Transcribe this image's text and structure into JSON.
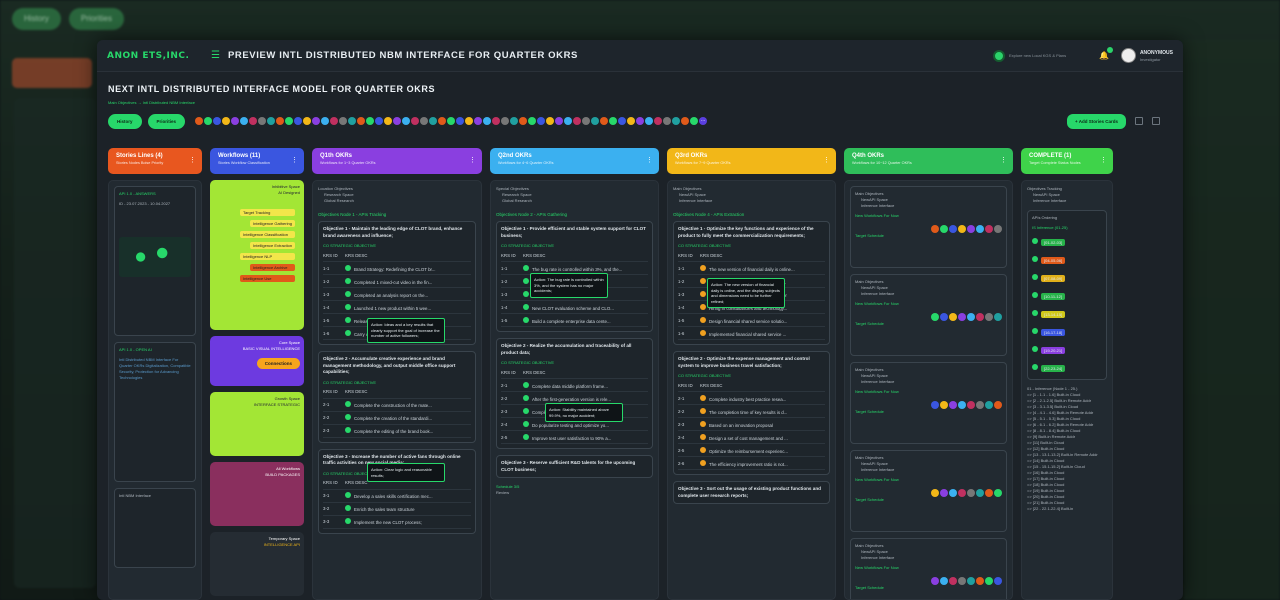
{
  "bg": {
    "history": "History",
    "settings": "Priorities",
    "col_title": "Stories Lines (4)"
  },
  "app": {
    "logo": "ANON ETS,INC.",
    "title": "PREVIEW INTL DISTRIBUTED NBM INTERFACE FOR QUARTER OKRS",
    "search_placeholder": "Explore new Local KGS & Plans",
    "user": "ANONYMOUS",
    "role": "Investigator"
  },
  "page": {
    "title": "NEXT INTL DISTRIBUTED INTERFACE MODEL FOR QUARTER OKRS",
    "breadcrumb": "Main Objectives → Intl Distributed NBM Interface",
    "history_btn": "History",
    "priorities_btn": "Priorities",
    "add_btn": "+ Add Stories Cards",
    "avatar_more": "..."
  },
  "columns": [
    {
      "title": "Stories Lines (4)",
      "sub": "Stories Nodes Boise Priority",
      "color": "#e8571f"
    },
    {
      "title": "Workflows (11)",
      "sub": "Stories Workflow Classification",
      "color": "#3a56e0"
    },
    {
      "title": "Q1th OKRs",
      "sub": "Workflows for 1~3 Quarter OKRs",
      "color": "#8a3fe0"
    },
    {
      "title": "Q2nd OKRs",
      "sub": "Workflows for 4~6 Quarter OKRs",
      "color": "#3bb0f0"
    },
    {
      "title": "Q3rd OKRs",
      "sub": "Workflows for 7~9 Quarter OKRs",
      "color": "#f2b718"
    },
    {
      "title": "Q4th OKRs",
      "sub": "Workflows for 10~12 Quarter OKRs",
      "color": "#2fbe5a"
    },
    {
      "title": "COMPLETE (1)",
      "sub": "Target Complete Status Nodes",
      "color": "#3fd34a"
    }
  ],
  "stories": {
    "card1_label": "API 1.0 - ANSWERS",
    "card1_text": "ID - 23.07.2023 - 10.04.2027",
    "card2_label": "API 1.0 - OPEN AI",
    "card2_text": "Intl Distributed NBM Interface For Quarter OKRs Digitalization, Compatible Security, Protection for Advancing Technologies",
    "card3_label": "Intl NBM Interface"
  },
  "workflows": {
    "w1_label": "Inhibitive Space",
    "w1_sub": "AI Designed",
    "flow": [
      "Target Tracking",
      "Intelligence Gathering",
      "Intelligence Classification",
      "Intelligence Extraction",
      "Intelligence NLP",
      "Intelligence Archive",
      "Intelligence Use"
    ],
    "w2_label": "Core Space",
    "w2_sub": "BASIC VISUAL INTELLIGENCE",
    "w2_btn": "Connections",
    "w3_label": "Growth Space",
    "w3_sub": "INTERFACE STRATEGIC",
    "w4_label": "All Workflows",
    "w4_sub": "BUILD PACKAGES",
    "w5_label": "Temporary Space",
    "w5_sub": "INTELLIGENCE API"
  },
  "q1": {
    "tags": [
      "Location Objectives",
      "Research Space",
      "Global Research"
    ],
    "section": "Objectives Node 1 - APIs Tracking",
    "obj1": "Objective 1 - Maintain the leading edge of CLOT brand, enhance brand awareness and influence;",
    "strat": "CO STRATEGIC OBJECTIVE",
    "krs_id": "KRS ID",
    "krs_desc": "KRS DESC",
    "rows1": [
      [
        "1-1",
        "Brand Strategy: Redefining the CLOT br..."
      ],
      [
        "1-2",
        "Completed 1 mixed-cut video in the fin..."
      ],
      [
        "1-3",
        "Completed an analysis report on the..."
      ],
      [
        "1-4",
        "Launched 1 new product within 5 wee..."
      ],
      [
        "1-5",
        "Release the brand booklet with the tr..."
      ],
      [
        "1-6",
        "Carry out at least 10 online forwarding..."
      ]
    ],
    "tip1": "Action: Ideas and a key results that clearly support the goal of increase the number of active followers;",
    "obj2": "Objective 2 - Accumulate creative experience and brand management methodology, and output middle office support capabilities;",
    "rows2": [
      [
        "2-1",
        "Complete the construction of the mate..."
      ],
      [
        "2-2",
        "Complete the creation of the standardi..."
      ],
      [
        "2-3",
        "Complete the editing of the brand book..."
      ]
    ],
    "tip2": "Action: Clear logic and reasonable results;",
    "obj3": "Objective 3 - Increase the number of active fans through online traffic activities on new social media;",
    "rows3": [
      [
        "3-1",
        "Develop a sales skills certification mec..."
      ],
      [
        "3-2",
        "Enrich the sales team structure"
      ],
      [
        "3-3",
        "Implement the new CLOT process;"
      ]
    ]
  },
  "q2": {
    "tags": [
      "Special Objectives",
      "Research Space",
      "Global Research"
    ],
    "section": "Objectives Node 2 - APIs Gathering",
    "obj1": "Objective 1 - Provide efficient and stable system support for CLOT business;",
    "rows1": [
      [
        "1-1",
        "The bug rate is controlled within 3%, and the..."
      ],
      [
        "1-2",
        "The CLOT solution is rolled smoothly"
      ],
      [
        "1-3",
        "Measurable Key Results"
      ],
      [
        "1-4",
        "New CLOT evaluation scheme and CLO..."
      ],
      [
        "1-5",
        "Build a complete enterprise data cente..."
      ]
    ],
    "tip1": "Action: The bug rate is controlled within 3%, and the system has no major accidents;",
    "obj2": "Objective 2 - Realize the accumulation and traceability of all product data;",
    "rows2": [
      [
        "2-1",
        "Complete data middle platform frame..."
      ],
      [
        "2-2",
        "After the first-generation version is rele..."
      ],
      [
        "2-3",
        "Completed the model construction of t..."
      ],
      [
        "2-4",
        "Do popularize testing and optimize yo..."
      ],
      [
        "2-5",
        "Improve test user satisfaction to 90% a..."
      ]
    ],
    "tip2": "Action: Stability maintained above 99.9%, no major accident;",
    "obj3": "Objective 3 - Reserve sufficient R&D talents for the upcoming CLOT business;",
    "foot": "Schedule 3/5",
    "foot2": "Review"
  },
  "q3": {
    "tags": [
      "Main Objectives",
      "NewAPI Space",
      "Inference Interface"
    ],
    "section": "Objectives Node 4 - APIs Extraction",
    "obj1": "Objective 1 - Optimize the key functions and experience of the product to fully meet the commercialization requirements;",
    "rows1": [
      [
        "1-1",
        "The new version of financial daily is online..."
      ],
      [
        "1-2",
        "The data update cycle is shortened to..."
      ],
      [
        "1-3",
        "Build a Financial Shared Service Center"
      ],
      [
        "1-4",
        "Hiring in consultancies and technology..."
      ],
      [
        "1-5",
        "Design financial shared service solutio..."
      ],
      [
        "1-6",
        "Implemented financial shared service ..."
      ]
    ],
    "tip1": "Action: The new version of financial daily is online, and the display subjects and dimensions need to be further refined;",
    "obj2": "Objective 2 - Optimize the expense management and control system to improve business travel satisfaction;",
    "rows2": [
      [
        "2-1",
        "Complete industry best practice resea..."
      ],
      [
        "2-2",
        "The completion time of key results is d..."
      ],
      [
        "2-3",
        "Based on an innovation proposal"
      ],
      [
        "2-4",
        "Design a set of cost management and ..."
      ],
      [
        "2-5",
        "Optimize the reimbursement experienc..."
      ],
      [
        "2-6",
        "The efficiency improvement ratio is not..."
      ]
    ],
    "obj3": "Objective 3 - Sort out the usage of existing product functions and complete user research reports;"
  },
  "q4": {
    "items": [
      {
        "a": "Main Objectives",
        "b": "NewAPI Space",
        "c": "Inference Interface",
        "d": "New Workflows For Now",
        "e": "Target Schedule"
      },
      {
        "a": "Main Objectives",
        "b": "NewAPI Space",
        "c": "Inference Interface",
        "d": "New Workflows For Now",
        "e": "Target Schedule"
      },
      {
        "a": "Main Objectives",
        "b": "NewAPI Space",
        "c": "Inference Interface",
        "d": "New Workflows For Now",
        "e": "Target Schedule"
      },
      {
        "a": "Main Objectives",
        "b": "NewAPI Space",
        "c": "Inference Interface",
        "d": "New Workflows For Now",
        "e": "Target Schedule"
      },
      {
        "a": "Main Objectives",
        "b": "NewAPI Space",
        "c": "Inference Interface",
        "d": "New Workflows For Now",
        "e": "Target Schedule"
      }
    ]
  },
  "complete": {
    "tags": [
      "Objectives Tracking",
      "NewAPI Space",
      "Inference Interface"
    ],
    "box": "APIs Ordering",
    "box_sub": "IS Inference (01-25)",
    "pills": [
      {
        "t": "[01-02-03]",
        "c": "#27b34a"
      },
      {
        "t": "[04-05-06]",
        "c": "#e05a1a"
      },
      {
        "t": "[07-08-09]",
        "c": "#e0b01a"
      },
      {
        "t": "[10-11-12]",
        "c": "#27b34a"
      },
      {
        "t": "[13-14-15]",
        "c": "#d0c81a"
      },
      {
        "t": "[16-17-18]",
        "c": "#3a56e0"
      },
      {
        "t": "[19-20-21]",
        "c": "#8a3fe0"
      },
      {
        "t": "[22-23-24]",
        "c": "#27b34a"
      }
    ],
    "list_title": "01 - Inference (Node 1 - 25.)",
    "list": [
      "=> [1 - 1.1 - 1.6] Built-in Cloud",
      "=> [2 - 2.1-2.5] Built-in Remote Addr",
      "=> [3 - 3.1-3.5] Built-in Cloud",
      "=> [4 - 4.1 - 4.6] Built-in Remote Addr",
      "=> [5 - 5.1 - 5.3] Built-in Cloud",
      "=> [6 - 6.1 - 6.2] Built-in Remote Addr",
      "=> [8 - 8.1 - 8.4] Built-in Cloud",
      "=> [9] Built-in Remote Addr",
      "=> [11] Built-in Cloud",
      "=> [12] Built-in Cloud",
      "=> [13 - 13.1-13.2] Built-in Remote Addr",
      "=> [14] Built-in Cloud",
      "=> [15 - 15.1-15.2] Built-in Cloud",
      "=> [16] Built-in Cloud",
      "=> [17] Built-in Cloud",
      "=> [18] Built-in Cloud",
      "=> [19] Built-in Cloud",
      "=> [20] Built-in Cloud",
      "=> [21] Built-in Cloud",
      "=> [22 - 22.1-22.4] Built-in"
    ]
  }
}
